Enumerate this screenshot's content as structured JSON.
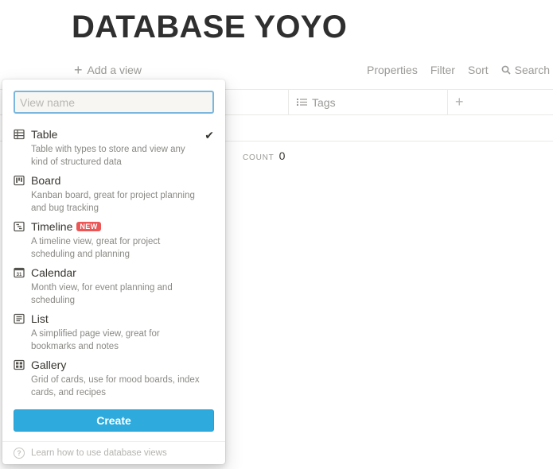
{
  "page": {
    "title": "DATABASE YOYO"
  },
  "header": {
    "add_view": "Add a view",
    "toolbar": {
      "properties": "Properties",
      "filter": "Filter",
      "sort": "Sort",
      "search": "Search"
    }
  },
  "table": {
    "columns": [
      {
        "label": "Tags",
        "icon": "list-icon"
      }
    ],
    "add_column": "+",
    "count_label": "COUNT",
    "count_value": "0"
  },
  "popup": {
    "input_placeholder": "View name",
    "views": [
      {
        "name": "Table",
        "desc": "Table with types to store and view any kind of structured data",
        "icon": "table-icon",
        "selected": true
      },
      {
        "name": "Board",
        "desc": "Kanban board, great for project planning and bug tracking",
        "icon": "board-icon"
      },
      {
        "name": "Timeline",
        "desc": "A timeline view, great for project scheduling and planning",
        "icon": "timeline-icon",
        "badge": "NEW"
      },
      {
        "name": "Calendar",
        "desc": "Month view, for event planning and scheduling",
        "icon": "calendar-icon"
      },
      {
        "name": "List",
        "desc": "A simplified page view, great for bookmarks and notes",
        "icon": "list-view-icon"
      },
      {
        "name": "Gallery",
        "desc": "Grid of cards, use for mood boards, index cards, and recipes",
        "icon": "gallery-icon"
      }
    ],
    "create_label": "Create",
    "learn_link": "Learn how to use database views",
    "colors": {
      "accent": "#2eaadc",
      "badge": "#eb5757"
    }
  }
}
